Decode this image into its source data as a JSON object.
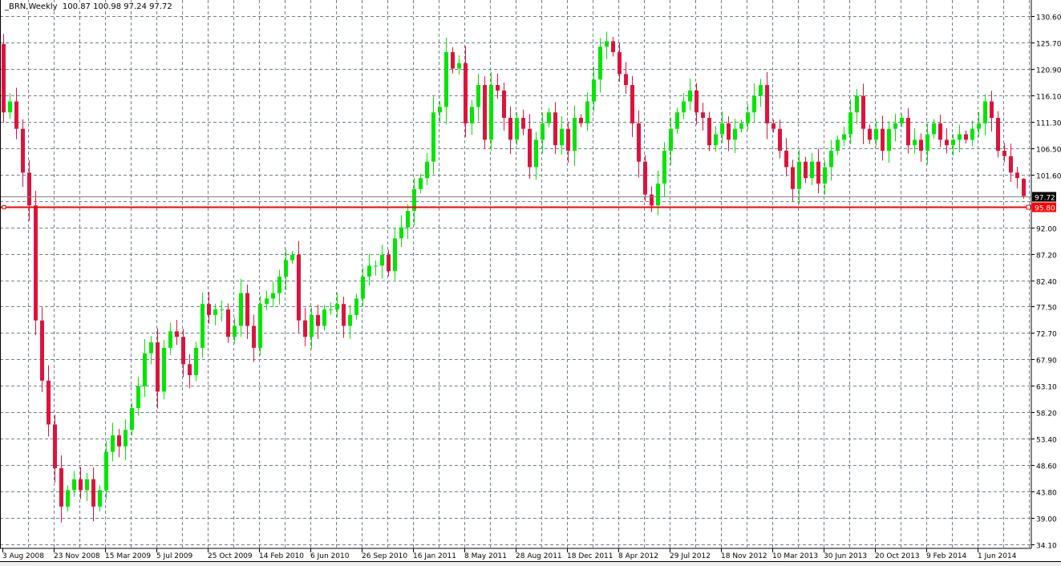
{
  "header": {
    "symbol": "_BRN,Weekly",
    "open": "100.87",
    "high": "100.98",
    "low": "97.24",
    "close": "97.72"
  },
  "colors": {
    "bull": "#00e600",
    "bear": "#dc143c",
    "grid": "#708090",
    "level_line": "#ff0000",
    "bid_line": "#808080"
  },
  "chart_data": {
    "type": "candlestick",
    "title": "_BRN,Weekly",
    "xlabel": "",
    "ylabel": "",
    "ylim": [
      34.1,
      130.6
    ],
    "grid": true,
    "yticks": [
      "130.60",
      "125.70",
      "120.90",
      "116.10",
      "111.30",
      "106.50",
      "101.60",
      "",
      "92.00",
      "87.20",
      "82.40",
      "77.50",
      "72.70",
      "67.90",
      "63.10",
      "58.20",
      "53.40",
      "48.60",
      "43.80",
      "39.00",
      "34.10"
    ],
    "xticks": [
      "3 Aug 2008",
      "23 Nov 2008",
      "15 Mar 2009",
      "5 Jul 2009",
      "25 Oct 2009",
      "14 Feb 2010",
      "6 Jun 2010",
      "26 Sep 2010",
      "16 Jan 2011",
      "8 May 2011",
      "28 Aug 2011",
      "18 Dec 2011",
      "8 Apr 2012",
      "29 Jul 2012",
      "18 Nov 2012",
      "10 Mar 2013",
      "30 Jun 2013",
      "20 Oct 2013",
      "9 Feb 2014",
      "1 Jun 2014"
    ],
    "first_open": 125.5,
    "close": [
      113,
      115,
      110,
      102,
      96,
      75,
      64,
      56,
      48,
      41,
      44,
      46,
      44,
      46,
      41,
      44,
      51,
      54,
      52,
      55,
      59,
      63,
      69,
      71,
      62,
      70,
      73,
      72,
      67,
      65,
      70,
      78,
      76,
      77,
      77,
      72,
      74,
      80,
      74,
      70,
      78,
      79,
      80,
      83,
      86,
      87,
      75,
      72,
      76,
      74,
      77,
      77,
      78,
      74,
      76,
      79,
      83,
      85,
      85,
      87,
      84,
      90,
      92,
      95,
      99,
      101,
      104,
      113,
      114,
      124,
      121,
      122,
      111,
      114,
      118,
      108,
      118,
      117,
      112,
      108,
      112,
      110,
      103,
      108,
      111,
      113,
      107,
      110,
      106,
      112,
      111,
      115,
      119,
      125,
      126,
      124,
      120,
      118,
      111,
      104,
      98,
      96,
      100,
      106,
      110,
      113,
      115,
      117,
      113,
      112,
      107,
      109,
      111,
      108,
      110,
      111,
      113,
      116,
      118,
      111,
      110,
      106,
      103,
      99,
      104,
      101,
      104,
      100,
      103,
      106,
      108,
      109,
      113,
      116,
      110,
      108,
      110,
      106,
      110,
      111,
      112,
      107,
      108,
      106,
      109,
      111,
      108,
      107,
      108,
      109,
      108,
      110,
      111,
      115,
      112,
      106,
      105,
      102,
      101,
      97.72
    ],
    "last_candle": {
      "open": 100.87,
      "high": 100.98,
      "low": 97.24,
      "close": 97.72
    },
    "current_price_label": "97.72",
    "level_line": {
      "value": 95.8,
      "label": "95.80"
    }
  }
}
